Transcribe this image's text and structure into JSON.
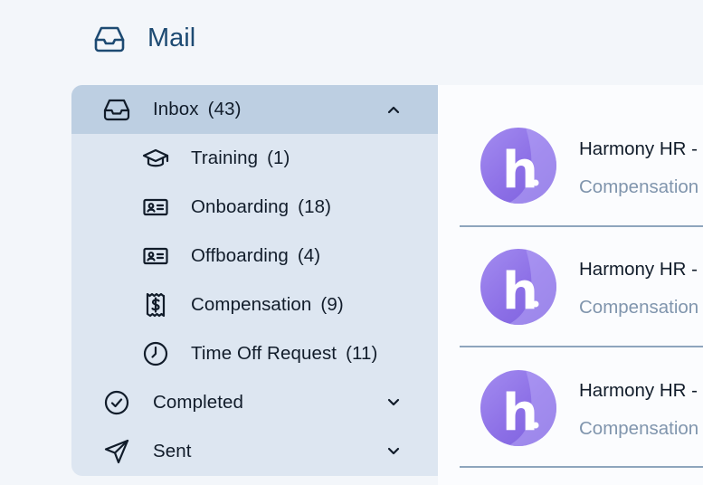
{
  "header": {
    "title": "Mail",
    "icon": "inbox-tray-icon"
  },
  "sidebar": {
    "inbox": {
      "label": "Inbox",
      "count": "(43)",
      "icon": "inbox-tray-icon",
      "expanded": true
    },
    "folders": [
      {
        "label": "Training",
        "count": "(1)",
        "icon": "graduation-cap-icon"
      },
      {
        "label": "Onboarding",
        "count": "(18)",
        "icon": "id-card-icon"
      },
      {
        "label": "Offboarding",
        "count": "(4)",
        "icon": "id-card-icon"
      },
      {
        "label": "Compensation",
        "count": "(9)",
        "icon": "receipt-dollar-icon"
      },
      {
        "label": "Time Off Request",
        "count": "(11)",
        "icon": "clock-icon"
      }
    ],
    "completed": {
      "label": "Completed",
      "icon": "check-circle-icon"
    },
    "sent": {
      "label": "Sent",
      "icon": "send-icon"
    }
  },
  "emails": [
    {
      "sender": "Harmony HR -",
      "subject": "Compensation",
      "avatar_letter": "h"
    },
    {
      "sender": "Harmony HR -",
      "subject": "Compensation",
      "avatar_letter": "h"
    },
    {
      "sender": "Harmony HR -",
      "subject": "Compensation",
      "avatar_letter": "h"
    }
  ],
  "colors": {
    "page_bg": "#f3f6fa",
    "sidebar_bg": "#dde6f1",
    "active_row_bg": "#bdcfe2",
    "title_color": "#1d4a72",
    "avatar_purple": "#8c6fe6",
    "subject_color": "#8095ad"
  }
}
